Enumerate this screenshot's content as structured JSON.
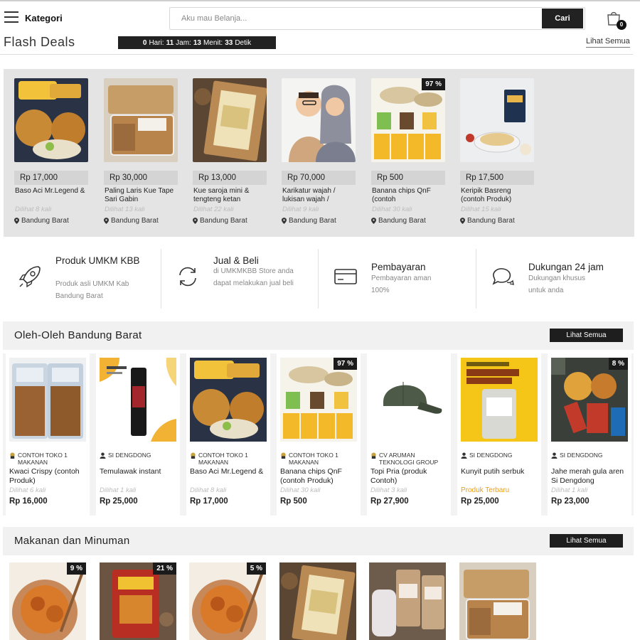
{
  "header": {
    "kategori_label": "Kategori",
    "search_placeholder": "Aku mau Belanja...",
    "search_button": "Cari",
    "cart_count": "0"
  },
  "flash": {
    "title": "Flash Deals",
    "countdown": {
      "hari": "0",
      "hari_label": "Hari:",
      "jam": "11",
      "jam_label": "Jam:",
      "menit": "13",
      "menit_label": "Menit:",
      "detik": "33",
      "detik_label": "Detik"
    },
    "see_all": "Lihat Semua",
    "items": [
      {
        "price": "Rp 17,000",
        "name": "Baso Aci Mr.Legend &",
        "viewed": "Dilihat 8 kali",
        "location": "Bandung Barat",
        "discount": ""
      },
      {
        "price": "Rp 30,000",
        "name": "Paling Laris Kue Tape Sari Gabin",
        "viewed": "Dilihat 13 kali",
        "location": "Bandung Barat",
        "discount": ""
      },
      {
        "price": "Rp 13,000",
        "name": "Kue saroja mini & tengteng ketan",
        "viewed": "Dilihat 22 kali",
        "location": "Bandung Barat",
        "discount": ""
      },
      {
        "price": "Rp 70,000",
        "name": "Karikatur wajah / lukisan wajah /",
        "viewed": "Dilihat 9 kali",
        "location": "Bandung Barat",
        "discount": ""
      },
      {
        "price": "Rp 500",
        "name": "Banana chips QnF (contoh",
        "viewed": "Dilihat 30 kali",
        "location": "Bandung Barat",
        "discount": "97 %"
      },
      {
        "price": "Rp 17,500",
        "name": "Keripik Basreng (contoh Produk)",
        "viewed": "Dilihat 15 kali",
        "location": "Bandung Barat",
        "discount": ""
      }
    ]
  },
  "features": [
    {
      "title": "Produk UMKM KBB",
      "desc": "Produk asli UMKM Kab Bandung Barat",
      "icon": "rocket-icon"
    },
    {
      "title": "Jual & Beli",
      "desc": "di UMKMKBB Store anda dapat melakukan jual beli",
      "icon": "refresh-icon"
    },
    {
      "title": "Pembayaran",
      "desc": "Pembayaran aman 100%",
      "icon": "credit-card-icon"
    },
    {
      "title": "Dukungan 24 jam",
      "desc": "Dukungan khusus untuk anda",
      "icon": "chat-icon"
    }
  ],
  "oleh_oleh": {
    "title": "Oleh-Oleh Bandung Barat",
    "see_all": "Lihat Semua",
    "items": [
      {
        "shop": "CONTOH TOKO 1 MAKANAN",
        "shop_icon": "store-icon",
        "name": "Kwaci Crispy (contoh Produk)",
        "tag": "",
        "viewed": "Dilihat 6 kali",
        "price": "Rp 16,000",
        "discount": ""
      },
      {
        "shop": "SI DENGDONG",
        "shop_icon": "user-icon",
        "name": "Temulawak instant",
        "tag": "",
        "viewed": "Dilihat 1 kali",
        "price": "Rp 25,000",
        "discount": ""
      },
      {
        "shop": "CONTOH TOKO 1 MAKANAN",
        "shop_icon": "store-icon",
        "name": "Baso Aci Mr.Legend &",
        "tag": "",
        "viewed": "Dilihat 8 kali",
        "price": "Rp 17,000",
        "discount": ""
      },
      {
        "shop": "CONTOH TOKO 1 MAKANAN",
        "shop_icon": "store-icon",
        "name": "Banana chips QnF (contoh Produk)",
        "tag": "",
        "viewed": "Dilihat 30 kali",
        "price": "Rp 500",
        "discount": "97 %"
      },
      {
        "shop": "CV ARUMAN TEKNOLOGI GROUP",
        "shop_icon": "store-icon",
        "name": "Topi Pria (produk Contoh)",
        "tag": "",
        "viewed": "Dilihat 3 kali",
        "price": "Rp 27,900",
        "discount": ""
      },
      {
        "shop": "SI DENGDONG",
        "shop_icon": "user-icon",
        "name": "Kunyit putih serbuk",
        "tag": "Produk Terbaru",
        "viewed": "",
        "price": "Rp 25,000",
        "discount": ""
      },
      {
        "shop": "SI DENGDONG",
        "shop_icon": "user-icon",
        "name": "Jahe merah gula aren Si Dengdong",
        "tag": "",
        "viewed": "Dilihat 1 kali",
        "price": "Rp 23,000",
        "discount": "8 %"
      }
    ]
  },
  "makanan": {
    "title": "Makanan dan Minuman",
    "see_all": "Lihat Semua",
    "items": [
      {
        "discount": "9 %"
      },
      {
        "discount": "21 %"
      },
      {
        "discount": "5 %"
      },
      {
        "discount": ""
      },
      {
        "discount": ""
      },
      {
        "discount": ""
      }
    ]
  },
  "colors": {
    "dark": "#1e1e1e",
    "panel": "#e4e4e4",
    "accent": "#e8a01c"
  }
}
